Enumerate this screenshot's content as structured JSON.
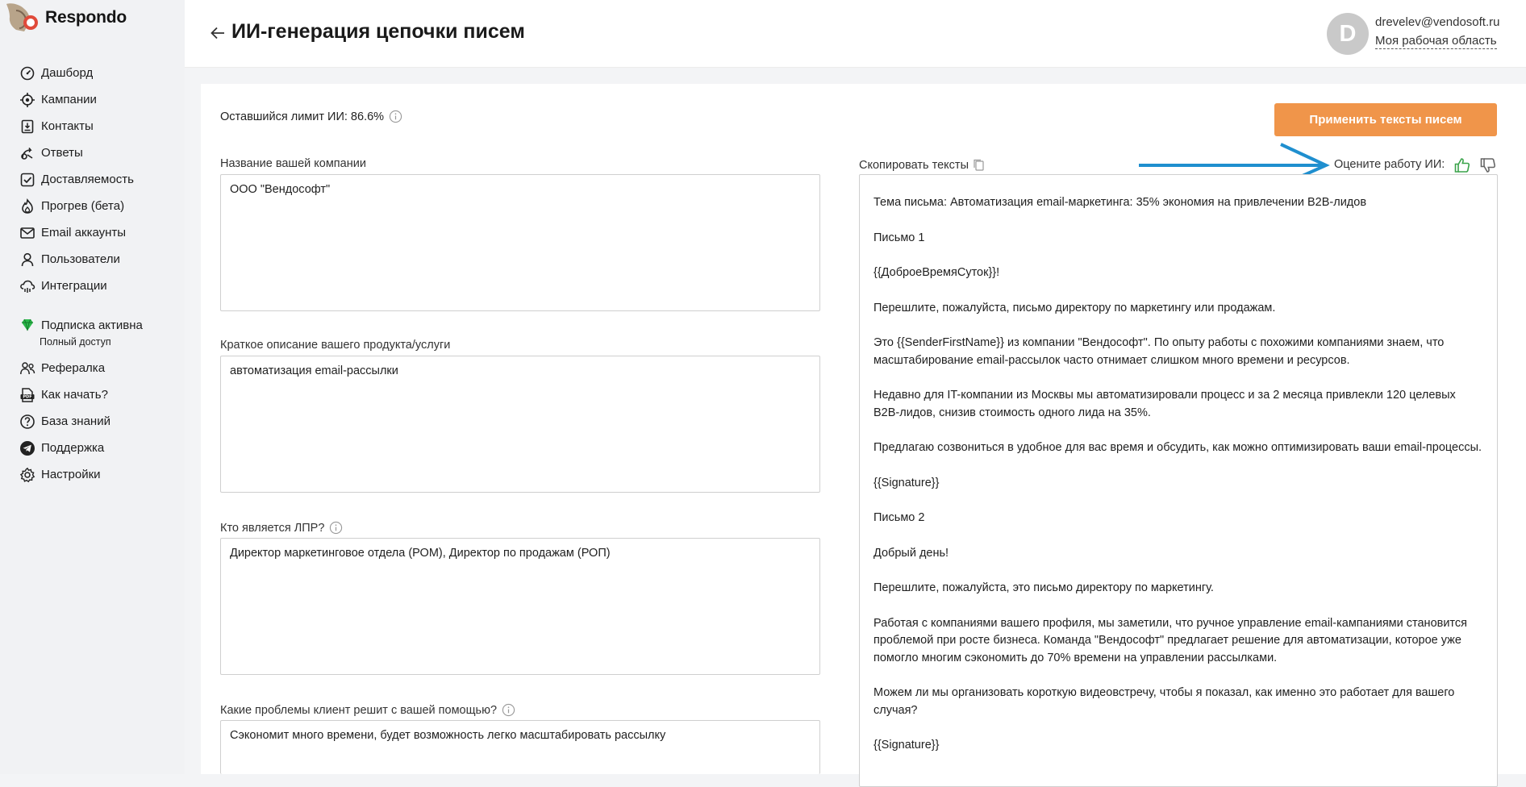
{
  "app": {
    "name": "Respondo"
  },
  "nav": {
    "items": [
      {
        "label": "Дашборд",
        "icon": "dashboard-icon"
      },
      {
        "label": "Кампании",
        "icon": "target-icon"
      },
      {
        "label": "Контакты",
        "icon": "contacts-icon"
      },
      {
        "label": "Ответы",
        "icon": "replies-icon"
      },
      {
        "label": "Доставляемость",
        "icon": "checkbox-icon"
      },
      {
        "label": "Прогрев (бета)",
        "icon": "flame-icon"
      },
      {
        "label": "Email аккаунты",
        "icon": "mail-icon"
      },
      {
        "label": "Пользователи",
        "icon": "user-icon"
      },
      {
        "label": "Интеграции",
        "icon": "cloud-icon"
      }
    ],
    "subscription": {
      "label": "Подписка активна",
      "note": "Полный доступ"
    },
    "items2": [
      {
        "label": "Рефералка",
        "icon": "referral-icon"
      },
      {
        "label": "Как начать?",
        "icon": "pdf-icon"
      },
      {
        "label": "База знаний",
        "icon": "help-icon"
      },
      {
        "label": "Поддержка",
        "icon": "telegram-icon"
      },
      {
        "label": "Настройки",
        "icon": "gear-icon"
      }
    ]
  },
  "header": {
    "title": "ИИ-генерация цепочки писем",
    "avatar_letter": "D",
    "email": "drevelev@vendosoft.ru",
    "workspace": "Моя рабочая область"
  },
  "limits": {
    "label": "Оставшийся лимит ИИ: 86.6%"
  },
  "apply_button": "Применить тексты писем",
  "form": {
    "company_label": "Название вашей компании",
    "company_value": "ООО \"Вендософт\"",
    "product_label": "Краткое описание вашего продукта/услуги",
    "product_value": "автоматизация email-рассылки",
    "dm_label": "Кто является ЛПР?",
    "dm_value": "Директор маркетинговое отдела (РОМ), Директор по продажам (РОП)",
    "problems_label": "Какие проблемы клиент решит с вашей помощью?",
    "problems_value": "Сэкономит много времени, будет возможность легко масштабировать рассылку"
  },
  "output": {
    "copy_label": "Скопировать тексты",
    "rate_label": "Оцените работу ИИ:",
    "colors": {
      "thumb_up": "#3aa34a",
      "arrow": "#1f8fcf",
      "accent": "#f0954a"
    },
    "paragraphs": [
      "Тема письма: Автоматизация email-маркетинга: 35% экономия на привлечении B2B-лидов",
      "Письмо 1",
      "{{ДоброеВремяСуток}}!",
      "Перешлите, пожалуйста, письмо директору по маркетингу или продажам.",
      "Это {{SenderFirstName}} из компании \"Вендософт\". По опыту работы с похожими компаниями знаем, что масштабирование email-рассылок часто отнимает слишком много времени и ресурсов.",
      "Недавно для IT-компании из Москвы мы автоматизировали процесс и за 2 месяца привлекли 120 целевых B2B-лидов, снизив стоимость одного лида на 35%.",
      "Предлагаю созвониться в удобное для вас время и обсудить, как можно оптимизировать ваши email-процессы.",
      "{{Signature}}",
      "Письмо 2",
      "Добрый день!",
      "Перешлите, пожалуйста, это письмо директору по маркетингу.",
      "Работая с компаниями вашего профиля, мы заметили, что ручное управление email-кампаниями становится проблемой при росте бизнеса. Команда \"Вендософт\" предлагает решение для автоматизации, которое уже помогло многим сэкономить до 70% времени на управлении рассылками.",
      "Можем ли мы организовать короткую видеовстречу, чтобы я показал, как именно это работает для вашего случая?",
      "{{Signature}}"
    ]
  }
}
